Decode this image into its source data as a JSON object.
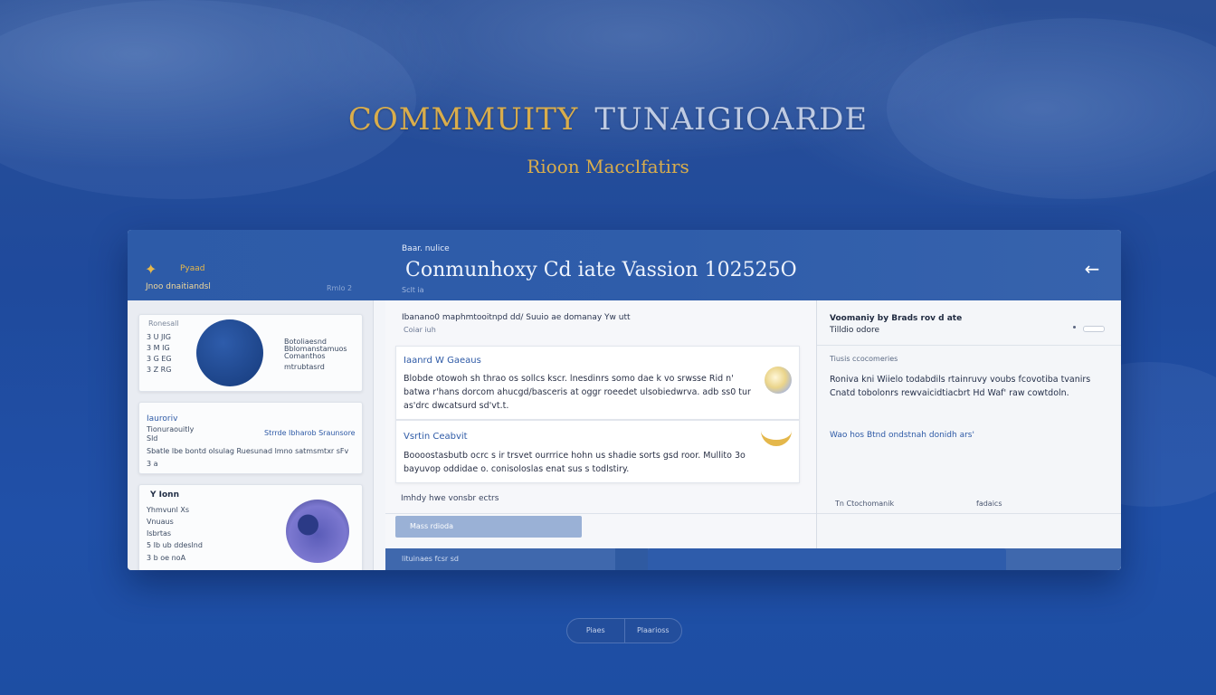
{
  "hero": {
    "title_gold": "COMMMUITY",
    "title_silver": "TUNAIGIOARDE",
    "subtitle": "Rioon Macclfatirs"
  },
  "header": {
    "sidebar_mark": "Pyaad",
    "sidebar_brand": "Jnoo dnaitiandsl",
    "sidebar_version": "Rmlo 2",
    "breadcrumb": "Baar. nulice",
    "title": "Conmunhoxy Cd iate Vassion 102525O",
    "meta": "Sclt ia",
    "back_label": "←"
  },
  "left": {
    "card1": {
      "label": "Ronesall",
      "rows": [
        "3 U  JIG",
        "3 M  IG",
        "3 G  EG",
        "3 Z  RG"
      ],
      "stats": [
        "Botoliaesnd",
        "Bblomanstamuos",
        "Comanthos mtrubtasrd"
      ]
    },
    "card2": {
      "title": "Iauroriv",
      "line1": "Tionuraouitly",
      "line2": "Sld",
      "link": "Strrde Ibharob Sraunsore",
      "body": "Sbatle lbe bontd olsulag Ruesunad lmno satmsmtxr sFv",
      "foot": "3 a"
    },
    "card3": {
      "title": "Y Ionn",
      "lines": [
        "Yhmvunl Xs",
        "Vnuaus",
        "Isbrtas",
        "5 Ib ub ddeslnd",
        "3 b oe noA"
      ]
    }
  },
  "middle": {
    "top_line": "Ibanano0 maphmtooitnpd dd/ Suuio ae domanay Yw utt",
    "top_sub": "Coiar  iuh",
    "card1": {
      "title": "Iaanrd W Gaeaus",
      "body": "Blobde otowoh sh thrao os sollcs kscr.  lnesdinrs somo dae k vo srwsse Rid  n' batwa r'hans dorcom  ahucgd/basceris at oggr roeedet ulsobiedwrva. adb ss0 tur as'drc dwcatsurd sd'vt.t."
    },
    "card2": {
      "title": "Vsrtin Ceabvit",
      "body": "Boooostasbutb ocrc s ir trsvet ourrrice hohn us shadie sorts gsd roor. Mullito 3o bayuvop oddidae o. conisoloslas enat sus  s todlstiry."
    },
    "footer_text": "Imhdy hwe vonsbr  ectrs",
    "button_label": "Mass rdioda",
    "bottom_label": "lituinaes fcsr sd"
  },
  "right": {
    "head_line1": "Voomaniy by Brads rov d ate",
    "head_line2": "Tilldio odore",
    "small_label": "Tiusis ccocomeries",
    "body": "Roniva kni  Wiielo todabdils rtainruvy voubs fcovotiba tvanirs Cnatd tobolonrs rewvaicidtiacbrt Hd Waf' raw  cowtdoln.",
    "link": "Wao hos Btnd ondstnah donidh ars'",
    "foot_left": "Tn Ctochomanik",
    "foot_right": "fadaics"
  },
  "pager": {
    "prev": "Piaes",
    "next": "Plaarioss"
  }
}
